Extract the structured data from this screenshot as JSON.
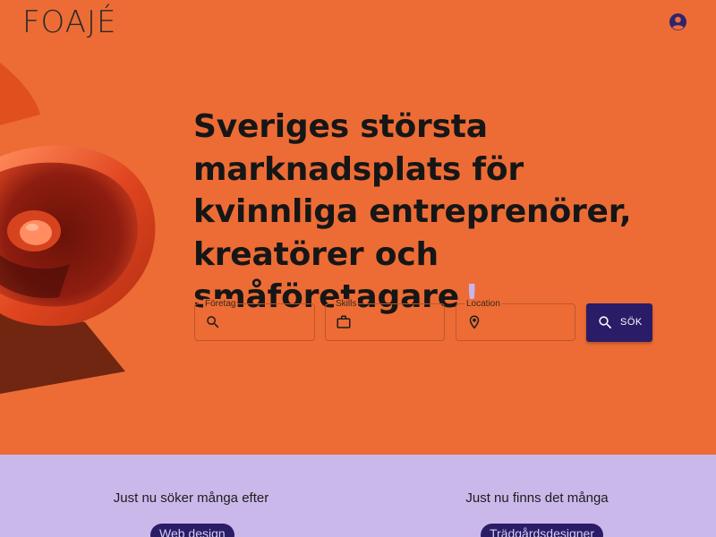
{
  "header": {
    "logo_text": "FOAJÉ",
    "account_icon": "account-circle-icon"
  },
  "hero": {
    "headline": "Sveriges största marknadsplats för kvinnliga entreprenörer, kreatörer och småföretagare",
    "headline_mark": "!",
    "image": "orange-megaphone"
  },
  "search": {
    "fields": [
      {
        "label": "Företag",
        "icon": "search-icon",
        "value": ""
      },
      {
        "label": "Skills",
        "icon": "briefcase-icon",
        "value": ""
      },
      {
        "label": "Location",
        "icon": "location-pin-icon",
        "value": ""
      }
    ],
    "button_label": "SÖK",
    "button_icon": "search-icon"
  },
  "popular": {
    "searching_title": "Just nu söker många efter",
    "searching_chip": "Web design",
    "available_title": "Just nu finns det många",
    "available_chip": "Trädgårdsdesigner"
  },
  "colors": {
    "background": "#ed6c35",
    "accent": "#2a1c66",
    "lower_band": "#cbb8ea"
  }
}
